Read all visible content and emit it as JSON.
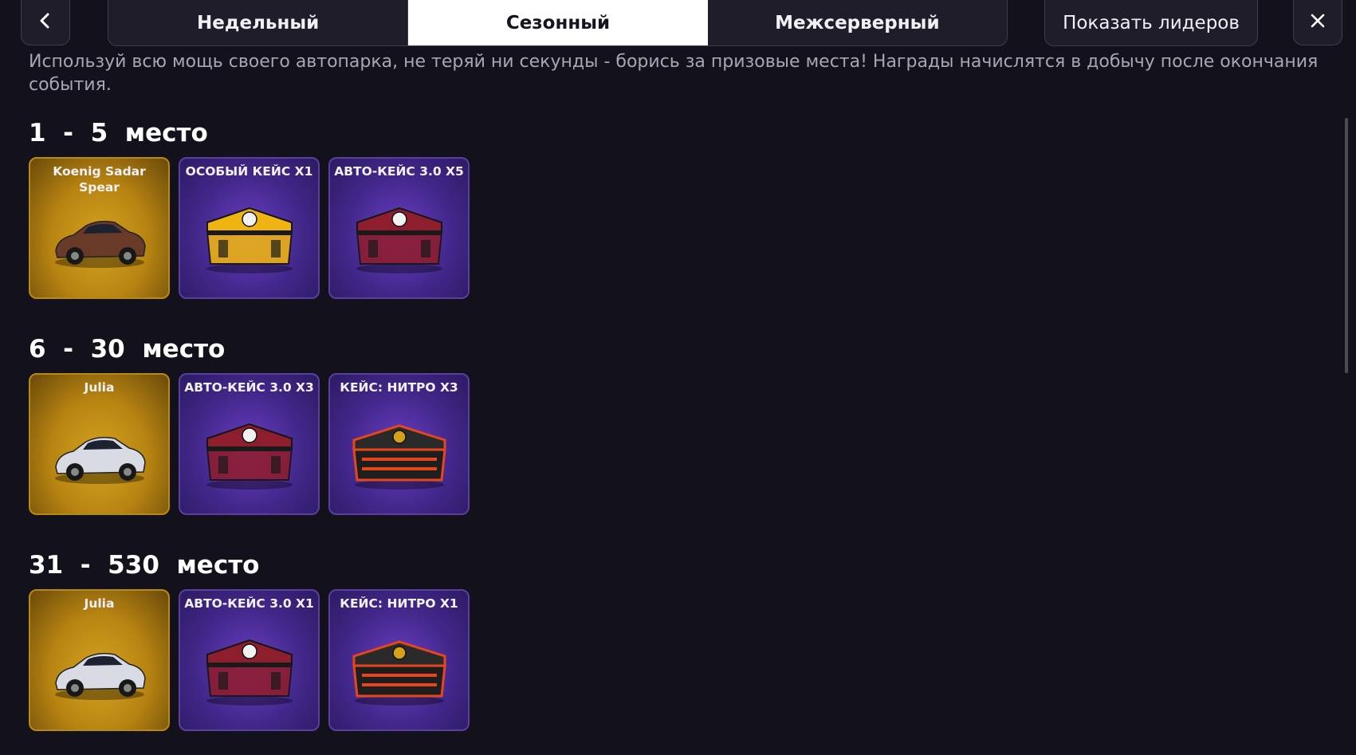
{
  "nav": {
    "back_icon": "chevron-left-icon",
    "close_icon": "close-icon",
    "tabs": [
      {
        "label": "Недельный",
        "active": false
      },
      {
        "label": "Сезонный",
        "active": true
      },
      {
        "label": "Межсерверный",
        "active": false
      }
    ],
    "leaders_button": "Показать лидеров"
  },
  "description": "Используй всю мощь своего автопарка, не теряй ни секунды - борись за призовые места! Награды начислятся в добычу после окончания события.",
  "tiers": [
    {
      "title": "1  -  5  место",
      "rewards": [
        {
          "label": "Koenig Sadar Spear",
          "type": "car",
          "icon": "car-icon",
          "color": "#6a3a28"
        },
        {
          "label": "ОСОБЫЙ КЕЙС X1",
          "type": "case",
          "icon": "special-case-icon",
          "color": "#f0b412"
        },
        {
          "label": "АВТО-КЕЙС 3.0 X5",
          "type": "case",
          "icon": "auto-case-icon",
          "color": "#8e1d2e"
        }
      ]
    },
    {
      "title": "6  -  30  место",
      "rewards": [
        {
          "label": "Julia",
          "type": "car",
          "icon": "car-icon",
          "color": "#d8dbe4"
        },
        {
          "label": "АВТО-КЕЙС 3.0 X3",
          "type": "case",
          "icon": "auto-case-icon",
          "color": "#8e1d2e"
        },
        {
          "label": "КЕЙС: НИТРО X3",
          "type": "case",
          "icon": "nitro-case-icon",
          "color": "#e8461a"
        }
      ]
    },
    {
      "title": "31  -  530  место",
      "rewards": [
        {
          "label": "Julia",
          "type": "car",
          "icon": "car-icon",
          "color": "#d8dbe4"
        },
        {
          "label": "АВТО-КЕЙС 3.0 X1",
          "type": "case",
          "icon": "auto-case-icon",
          "color": "#8e1d2e"
        },
        {
          "label": "КЕЙС: НИТРО X1",
          "type": "case",
          "icon": "nitro-case-icon",
          "color": "#e8461a"
        }
      ]
    }
  ]
}
